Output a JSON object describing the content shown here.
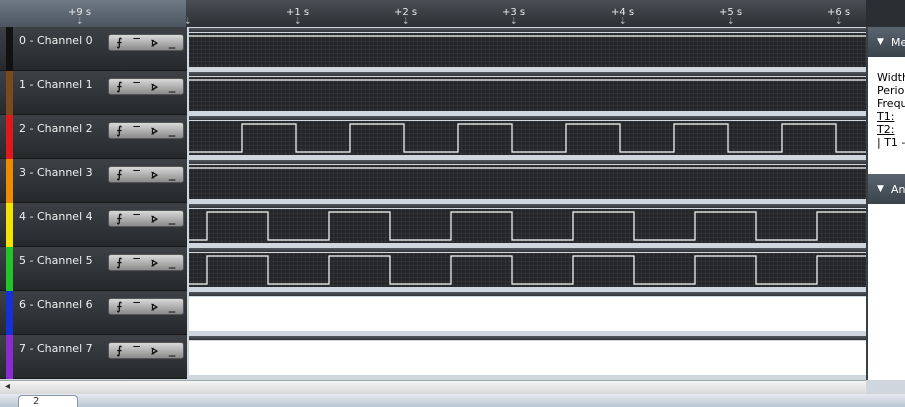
{
  "ruler": {
    "ticks": [
      "+9 s",
      "+1 s",
      "+2 s",
      "+3 s",
      "+4 s",
      "+5 s",
      "+6 s"
    ]
  },
  "channels": [
    {
      "label": "0 - Channel 0",
      "color": "#111111",
      "signal": "flat-high"
    },
    {
      "label": "1 - Channel 1",
      "color": "#7a4a1e",
      "signal": "flat-high"
    },
    {
      "label": "2 - Channel 2",
      "color": "#e01818",
      "signal": "square-a"
    },
    {
      "label": "3 - Channel 3",
      "color": "#f08a00",
      "signal": "flat-high"
    },
    {
      "label": "4 - Channel 4",
      "color": "#f2e400",
      "signal": "square-b"
    },
    {
      "label": "5 - Channel 5",
      "color": "#22c42a",
      "signal": "square-b"
    },
    {
      "label": "6 - Channel 6",
      "color": "#1430d8",
      "signal": "white"
    },
    {
      "label": "7 - Channel 7",
      "color": "#8a2ad0",
      "signal": "white"
    }
  ],
  "trigger_buttons": {
    "rising": "⨍",
    "high": "‾",
    "falling": "⦠",
    "low": "_"
  },
  "side_panel": {
    "measure_header": "Me",
    "measure_items": [
      "Width",
      "Period",
      "Frequ",
      "T1:",
      "T2:",
      "| T1 -"
    ],
    "analyzers_header": "An"
  },
  "bottom_tab": "2"
}
